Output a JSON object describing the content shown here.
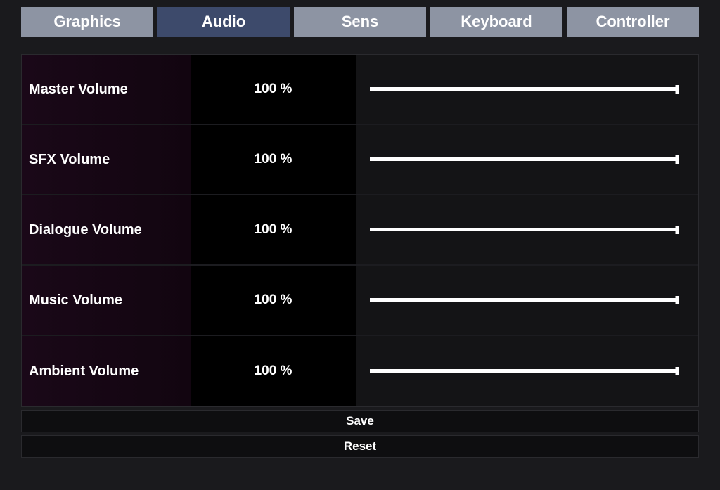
{
  "tabs": [
    {
      "label": "Graphics",
      "active": false
    },
    {
      "label": "Audio",
      "active": true
    },
    {
      "label": "Sens",
      "active": false
    },
    {
      "label": "Keyboard",
      "active": false
    },
    {
      "label": "Controller",
      "active": false
    }
  ],
  "settings": [
    {
      "label": "Master Volume",
      "value": "100 %",
      "percent": 100
    },
    {
      "label": "SFX Volume",
      "value": "100 %",
      "percent": 100
    },
    {
      "label": "Dialogue Volume",
      "value": "100 %",
      "percent": 100
    },
    {
      "label": "Music Volume",
      "value": "100 %",
      "percent": 100
    },
    {
      "label": "Ambient Volume",
      "value": "100 %",
      "percent": 100
    }
  ],
  "buttons": {
    "save": "Save",
    "reset": "Reset"
  }
}
